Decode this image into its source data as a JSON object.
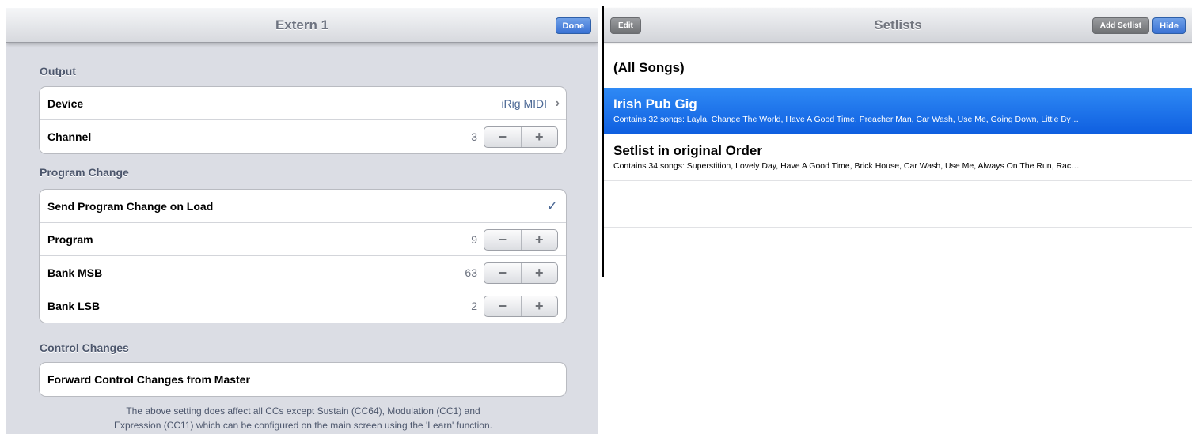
{
  "left": {
    "nav_title": "Extern 1",
    "done_label": "Done",
    "sections": {
      "output": "Output",
      "program_change": "Program Change",
      "control_changes": "Control Changes"
    },
    "rows": {
      "device_label": "Device",
      "device_value": "iRig MIDI",
      "channel_label": "Channel",
      "channel_value": "3",
      "send_pc_label": "Send Program Change on Load",
      "send_pc_checked": true,
      "program_label": "Program",
      "program_value": "9",
      "bank_msb_label": "Bank MSB",
      "bank_msb_value": "63",
      "bank_lsb_label": "Bank LSB",
      "bank_lsb_value": "2",
      "forward_cc_label": "Forward Control Changes from Master"
    },
    "stepper": {
      "minus": "−",
      "plus": "+"
    },
    "icons": {
      "chevron": "›",
      "check": "✓"
    },
    "footer_line1": "The above setting does affect all CCs except Sustain (CC64), Modulation (CC1) and",
    "footer_line2": "Expression (CC11) which can be configured on the main screen using the 'Learn' function."
  },
  "right": {
    "nav_title": "Setlists",
    "edit_label": "Edit",
    "add_setlist_label": "Add Setlist",
    "hide_label": "Hide",
    "setlists": [
      {
        "title": "(All Songs)",
        "subtitle": ""
      },
      {
        "title": "Irish Pub Gig",
        "subtitle": "Contains 32 songs: Layla, Change The World, Have A Good Time, Preacher Man, Car Wash, Use Me, Going Down, Little By…"
      },
      {
        "title": "Setlist in original Order",
        "subtitle": "Contains 34 songs: Superstition, Lovely Day, Have A Good Time, Brick House, Car Wash, Use Me, Always On The Run, Rac…"
      }
    ],
    "selected_index": 1
  },
  "colors": {
    "selection_blue": "#1a6fe8",
    "nav_button_blue": "#3a72d4",
    "group_background": "#dbdde4"
  }
}
